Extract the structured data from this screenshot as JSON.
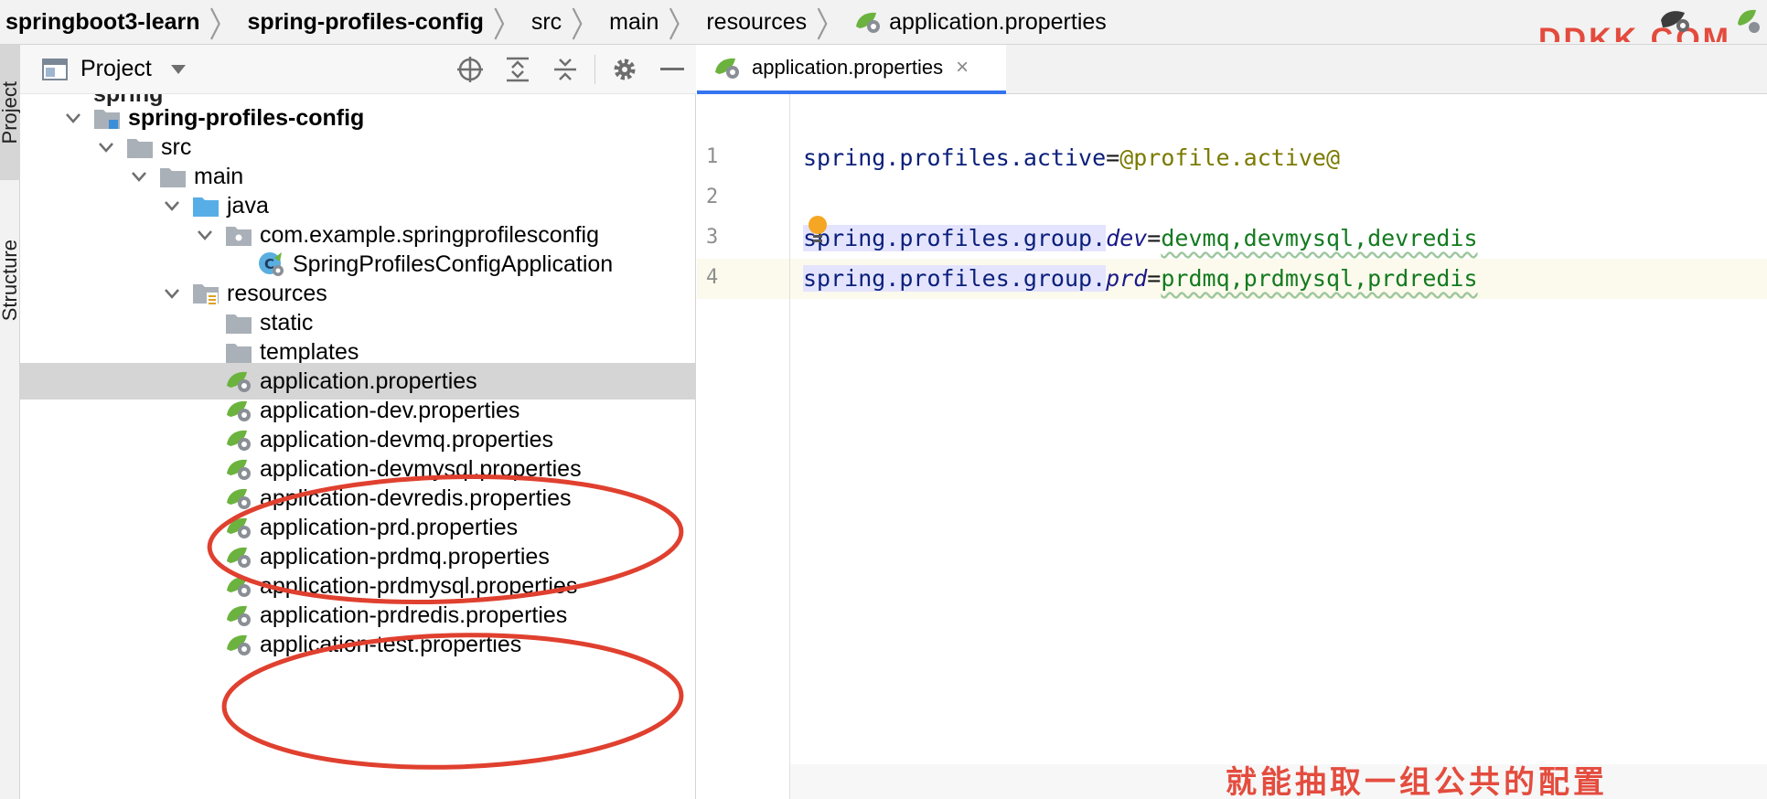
{
  "breadcrumb": {
    "items": [
      "springboot3-learn",
      "spring-profiles-config",
      "src",
      "main",
      "resources",
      "application.properties"
    ],
    "separator": "〉"
  },
  "watermark": {
    "top_text": "DDKK.COM",
    "bottom_text": "就能抽取一组公共的配置"
  },
  "tool_strip": {
    "project_label": "Project",
    "structure_label": "Structure"
  },
  "project_panel": {
    "title": "Project"
  },
  "tree": {
    "partial_top": "spring",
    "module": "spring-profiles-config",
    "src": "src",
    "main": "main",
    "java": "java",
    "package": "com.example.springprofilesconfig",
    "app_class": "SpringProfilesConfigApplication",
    "resources": "resources",
    "static": "static",
    "templates": "templates",
    "files": [
      "application.properties",
      "application-dev.properties",
      "application-devmq.properties",
      "application-devmysql.properties",
      "application-devredis.properties",
      "application-prd.properties",
      "application-prdmq.properties",
      "application-prdmysql.properties",
      "application-prdredis.properties",
      "application-test.properties"
    ]
  },
  "editor": {
    "tab_label": "application.properties",
    "tab_close": "×",
    "line_numbers": [
      "1",
      "2",
      "3",
      "4"
    ],
    "lines": {
      "l1_key": "spring.profiles.active",
      "l1_eq": "=",
      "l1_val": "@profile.active@",
      "l3_key": "spring.profiles.group.",
      "l3_sub": "dev",
      "l3_eq": "=",
      "l3_val": "devmq,devmysql,devredis",
      "l4_key": "spring.profiles.group.",
      "l4_sub": "prd",
      "l4_eq": "=",
      "l4_val": "prdmq,prdmysql,prdredis"
    }
  },
  "colors": {
    "accent_tab": "#3574f0",
    "annotation_red": "#e0402f",
    "spring_green": "#6bb33e",
    "folder_gray": "#a9b0b8",
    "java_folder_blue": "#57aee6"
  }
}
